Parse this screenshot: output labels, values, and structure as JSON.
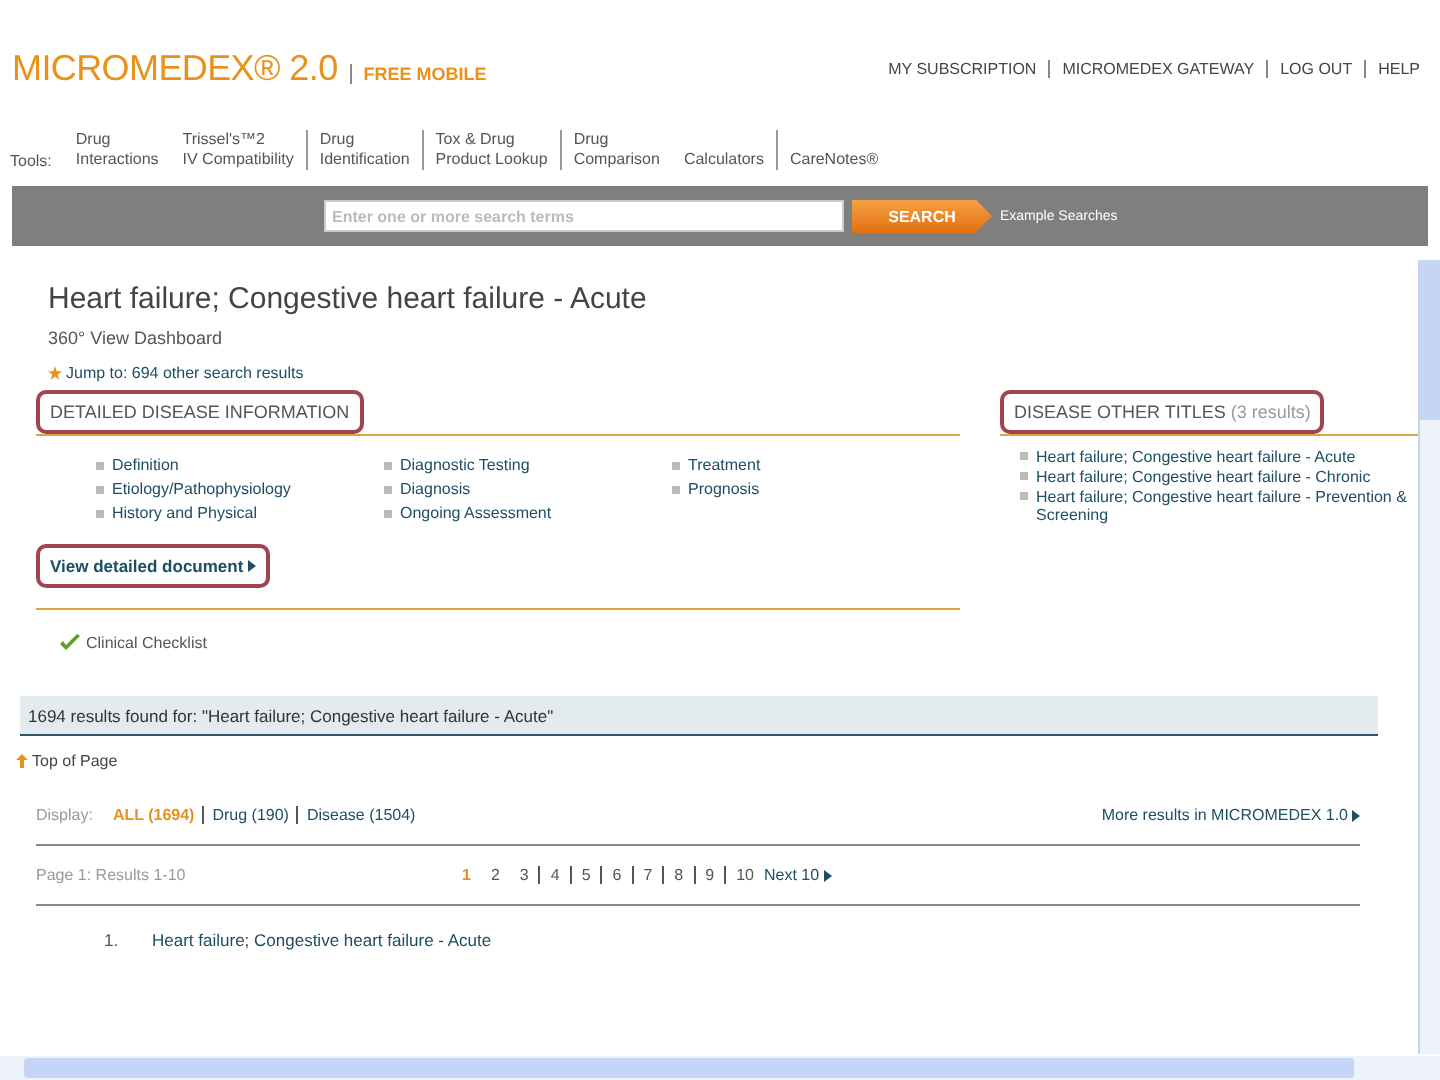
{
  "header": {
    "logo": "MICROMEDEX® 2.0",
    "edition": "FREE MOBILE",
    "links": [
      "MY SUBSCRIPTION",
      "MICROMEDEX GATEWAY",
      "LOG OUT",
      "HELP"
    ]
  },
  "tools": {
    "label": "Tools:",
    "items": [
      {
        "line1": "Drug",
        "line2": "Interactions"
      },
      {
        "line1": "Trissel's™2",
        "line2": "IV Compatibility"
      },
      {
        "line1": "Drug",
        "line2": "Identification"
      },
      {
        "line1": "Tox & Drug",
        "line2": "Product Lookup"
      },
      {
        "line1": "Drug",
        "line2": "Comparison"
      },
      {
        "line2": "Calculators"
      },
      {
        "line2": "CareNotes®"
      }
    ]
  },
  "search": {
    "placeholder": "Enter one or more search terms",
    "button": "SEARCH",
    "examples": "Example Searches"
  },
  "document": {
    "title": "Heart failure; Congestive heart failure - Acute",
    "subtitle": "360° View Dashboard",
    "jump": "Jump to: 694 other search results",
    "detail": {
      "heading": "DETAILED DISEASE INFORMATION",
      "highlighted": true,
      "columns": [
        [
          "Definition",
          "Etiology/Pathophysiology",
          "History and Physical"
        ],
        [
          "Diagnostic Testing",
          "Diagnosis",
          "Ongoing Assessment"
        ],
        [
          "Treatment",
          "Prognosis"
        ]
      ],
      "view_link": "View detailed document",
      "view_highlighted": true,
      "checklist": "Clinical Checklist"
    },
    "other_titles": {
      "heading": "DISEASE OTHER TITLES",
      "count": "(3 results)",
      "highlighted": true,
      "items": [
        "Heart failure; Congestive heart failure - Acute",
        "Heart failure; Congestive heart failure - Chronic",
        "Heart failure; Congestive heart failure - Prevention & Screening"
      ]
    }
  },
  "results": {
    "summary": "1694 results found for: \"Heart failure; Congestive heart failure - Acute\"",
    "top_link": "Top of Page",
    "display_label": "Display:",
    "filters": [
      {
        "label": "ALL (1694)",
        "selected": true
      },
      {
        "label": "Drug (190)",
        "selected": false
      },
      {
        "label": "Disease (1504)",
        "selected": false
      }
    ],
    "more": "More results in MICROMEDEX 1.0",
    "page_info": "Page 1: Results 1-10",
    "pages": [
      {
        "label": "1",
        "selected": true
      },
      {
        "label": "2",
        "selected": false
      },
      {
        "label": "3",
        "selected": false
      },
      {
        "label": "4",
        "selected": false
      },
      {
        "label": "5",
        "selected": false
      },
      {
        "label": "6",
        "selected": false
      },
      {
        "label": "7",
        "selected": false
      },
      {
        "label": "8",
        "selected": false
      },
      {
        "label": "9",
        "selected": false
      },
      {
        "label": "10",
        "selected": false
      }
    ],
    "next": "Next 10",
    "items": [
      {
        "number": "1.",
        "title": "Heart failure; Congestive heart failure - Acute"
      }
    ]
  }
}
